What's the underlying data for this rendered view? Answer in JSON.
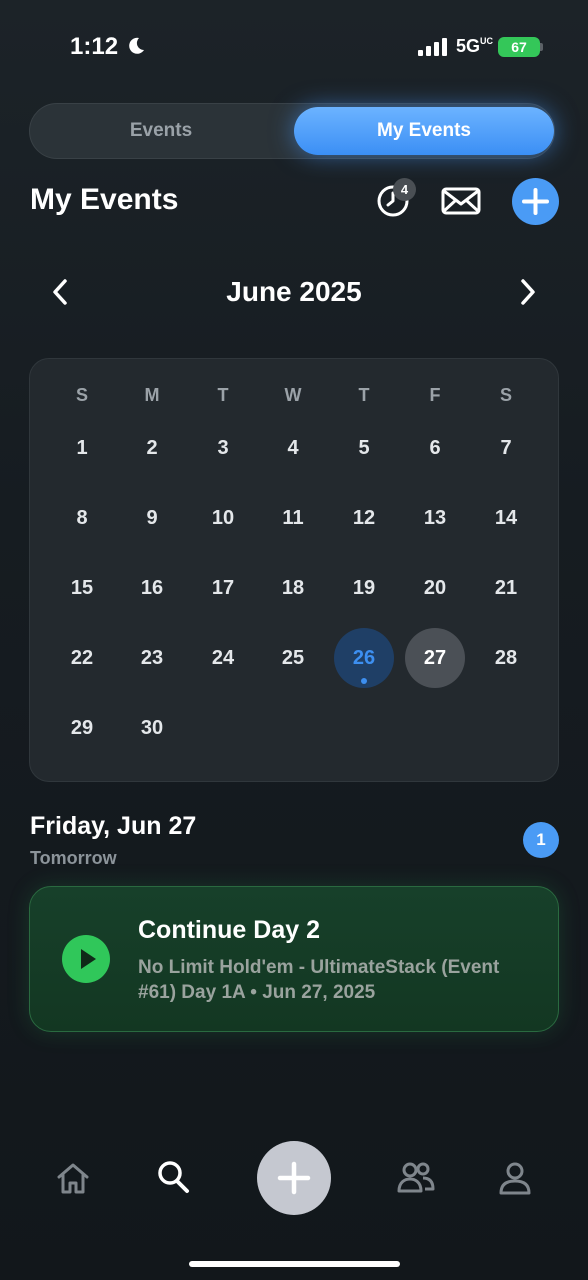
{
  "status_bar": {
    "time": "1:12",
    "network": "5G",
    "network_suffix": "UC",
    "battery": "67"
  },
  "segmented_control": {
    "tab_events": "Events",
    "tab_my_events": "My Events",
    "active": "My Events"
  },
  "header": {
    "title": "My Events",
    "history_badge": "4",
    "icons": [
      "history-icon",
      "mail-icon",
      "plus-icon"
    ]
  },
  "calendar": {
    "month_label": "June 2025",
    "weekdays": [
      "S",
      "M",
      "T",
      "W",
      "T",
      "F",
      "S"
    ],
    "today": "26",
    "selected": "27",
    "weeks": [
      [
        "1",
        "2",
        "3",
        "4",
        "5",
        "6",
        "7"
      ],
      [
        "8",
        "9",
        "10",
        "11",
        "12",
        "13",
        "14"
      ],
      [
        "15",
        "16",
        "17",
        "18",
        "19",
        "20",
        "21"
      ],
      [
        "22",
        "23",
        "24",
        "25",
        "26",
        "27",
        "28"
      ],
      [
        "29",
        "30"
      ]
    ]
  },
  "day_section": {
    "heading": "Friday, Jun 27",
    "subheading": "Tomorrow",
    "count": "1"
  },
  "event_card": {
    "title": "Continue Day 2",
    "description": "No Limit Hold'em - UltimateStack (Event #61) Day 1A • Jun 27, 2025",
    "accent_color": "#30c75a"
  },
  "tab_bar": {
    "items": [
      "home-icon",
      "search-icon",
      "plus-icon",
      "friends-icon",
      "profile-icon"
    ]
  },
  "colors": {
    "accent": "#4a9bf5",
    "success": "#34c759",
    "background": "#161c21"
  }
}
